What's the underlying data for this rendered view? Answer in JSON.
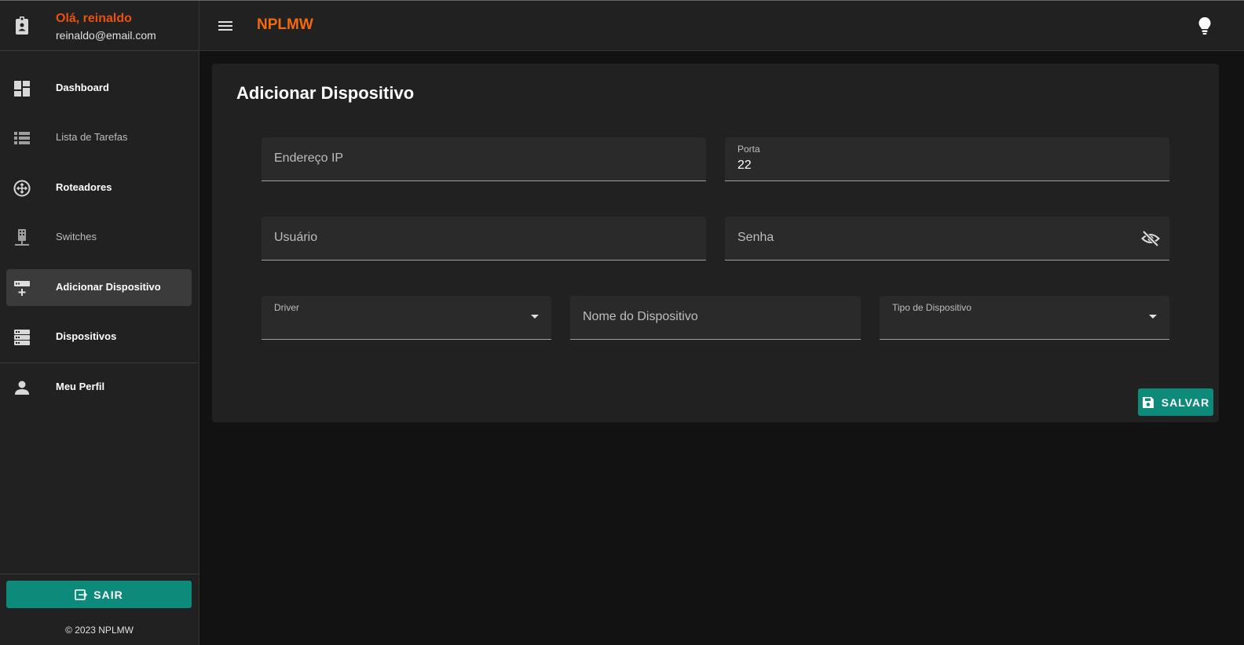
{
  "user": {
    "greeting": "Olá, reinaldo",
    "email": "reinaldo@email.com",
    "icon": "badge-icon"
  },
  "nav": {
    "items": [
      {
        "label": "Dashboard",
        "icon": "dashboard-icon",
        "active": false
      },
      {
        "label": "Lista de Tarefas",
        "icon": "list-icon",
        "active": false
      },
      {
        "label": "Roteadores",
        "icon": "router-icon",
        "active": false
      },
      {
        "label": "Switches",
        "icon": "switch-icon",
        "active": false
      },
      {
        "label": "Adicionar Dispositivo",
        "icon": "add-device-icon",
        "active": true
      },
      {
        "label": "Dispositivos",
        "icon": "devices-icon",
        "active": false
      },
      {
        "label": "Meu Perfil",
        "icon": "person-icon",
        "active": false
      }
    ]
  },
  "logout_label": "SAIR",
  "copyright": "© 2023 NPLMW",
  "appbar": {
    "title": "NPLMW"
  },
  "card": {
    "title": "Adicionar Dispositivo"
  },
  "form": {
    "ip": {
      "placeholder": "Endereço IP"
    },
    "port": {
      "label": "Porta",
      "value": "22"
    },
    "user": {
      "placeholder": "Usuário"
    },
    "password": {
      "placeholder": "Senha"
    },
    "driver": {
      "label": "Driver"
    },
    "device_name": {
      "placeholder": "Nome do Dispositivo"
    },
    "device_type": {
      "label": "Tipo de Dispositivo"
    }
  },
  "save_label": "SALVAR",
  "colors": {
    "accent": "#e8510f",
    "title": "#f26a10",
    "button": "#0d8a7a",
    "surface": "#212121",
    "background": "#121212"
  }
}
